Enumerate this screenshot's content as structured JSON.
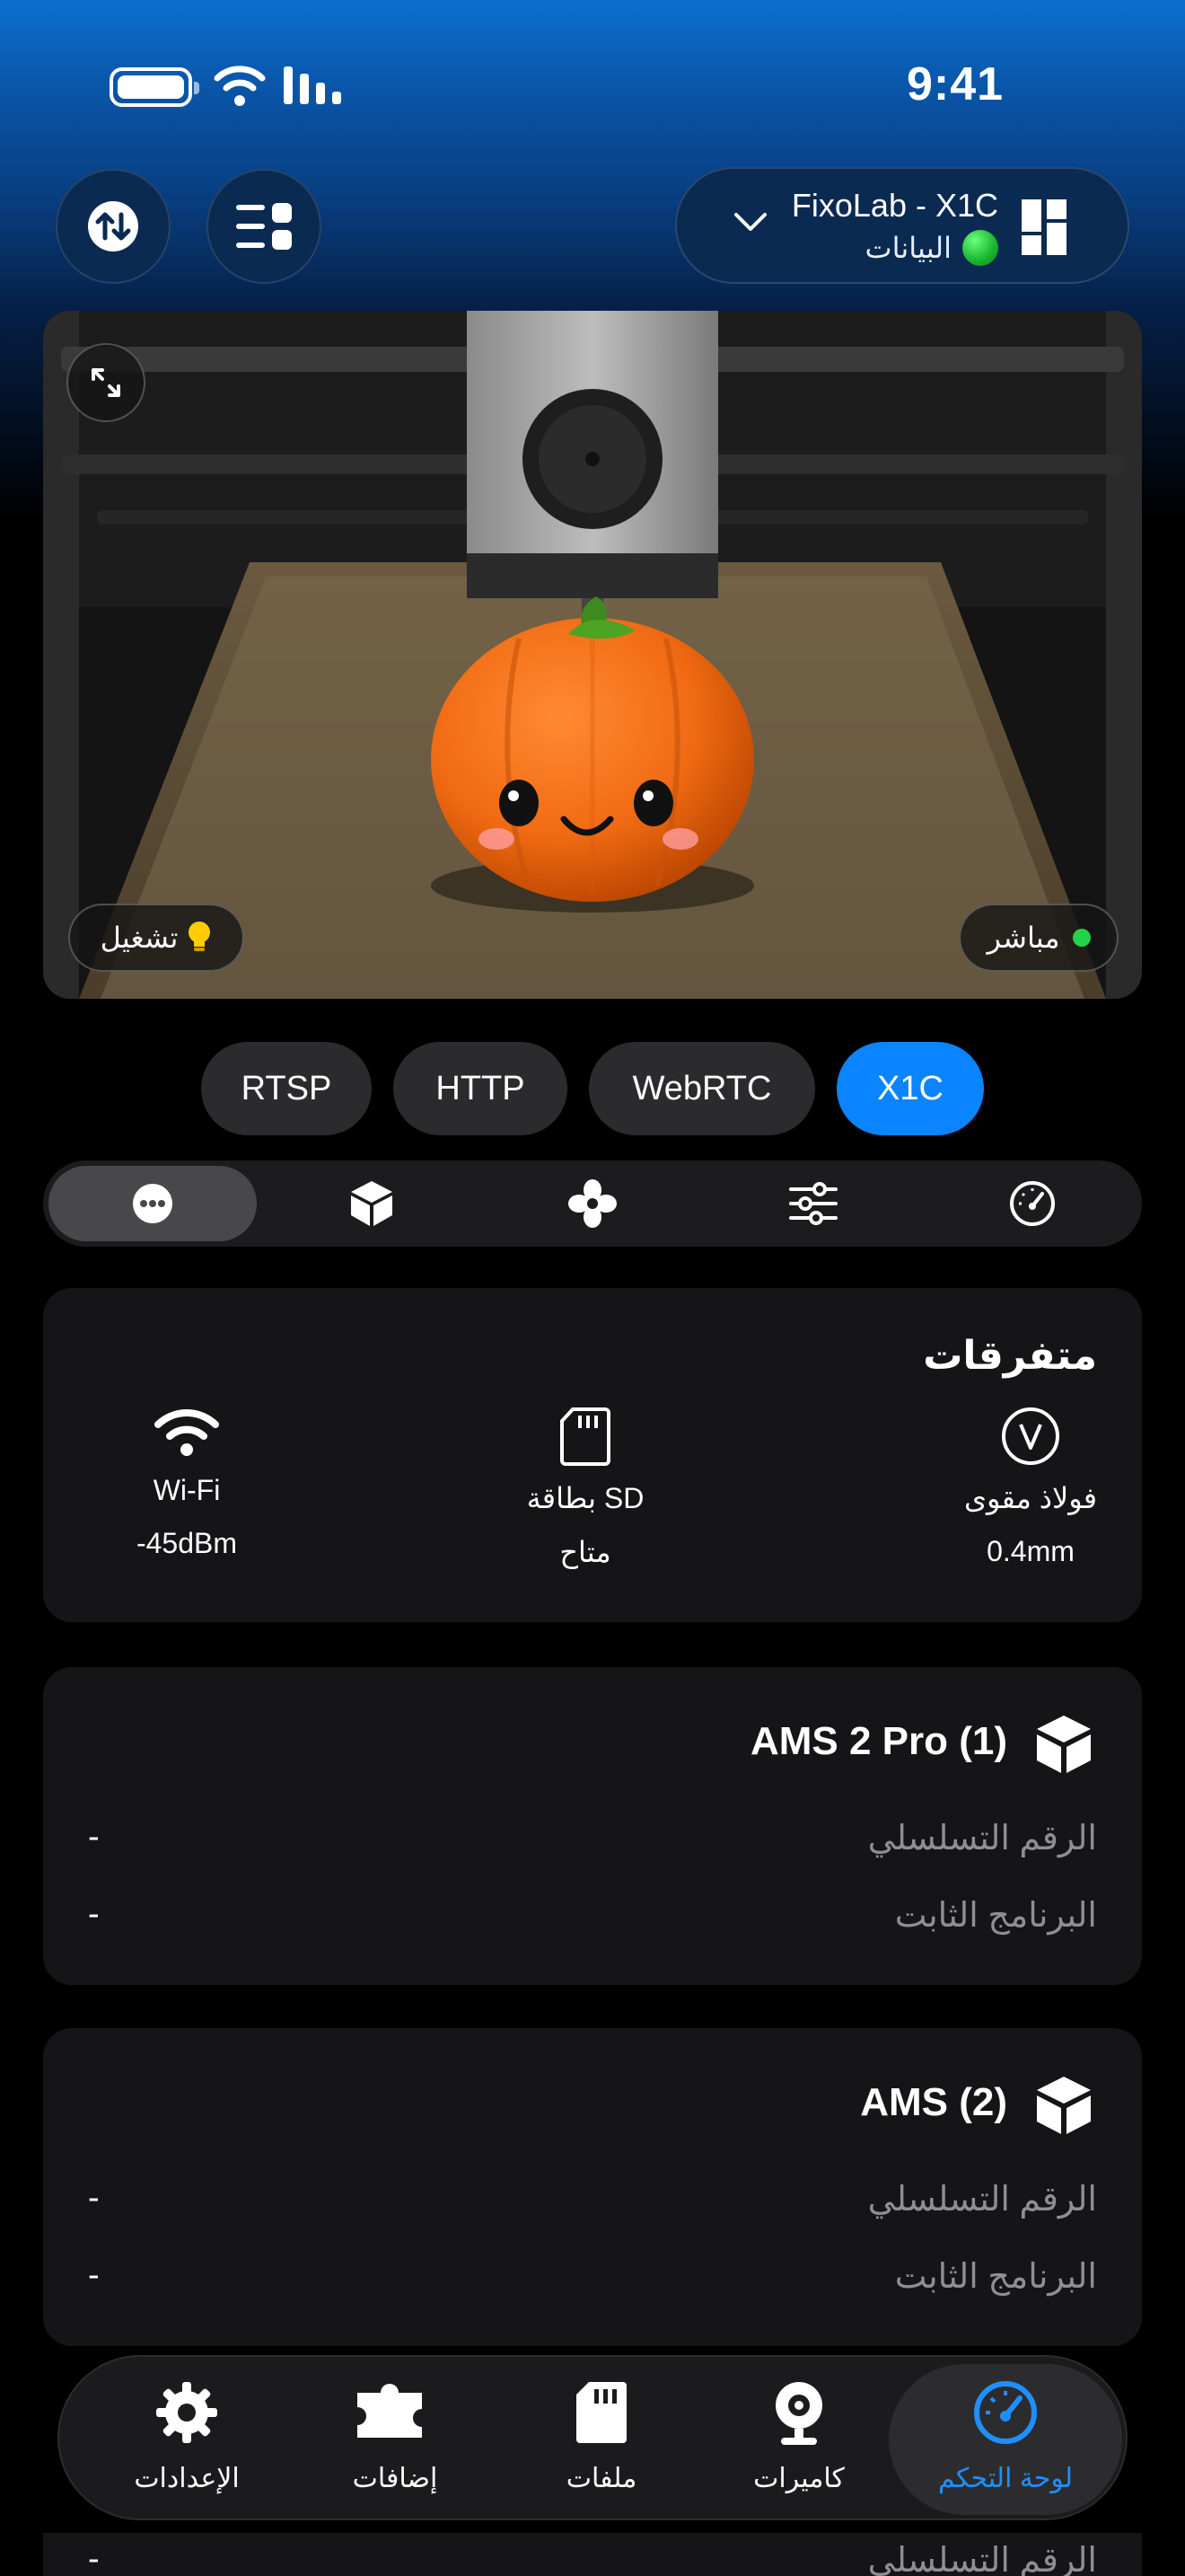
{
  "status_bar": {
    "time": "9:41"
  },
  "header": {
    "printer_name": "FixoLab - X1C",
    "printer_status": "البيانات"
  },
  "camera": {
    "light_label": "تشغيل",
    "live_label": "مباشر"
  },
  "sources": [
    "X1C",
    "WebRTC",
    "HTTP",
    "RTSP"
  ],
  "active_source": "X1C",
  "segments": [
    "more-icon",
    "cube-icon",
    "fan-icon",
    "sliders-icon",
    "gauge-icon"
  ],
  "misc": {
    "title": "متفرقات",
    "items": [
      {
        "icon": "wifi-icon",
        "label": "Wi-Fi",
        "value": "-45dBm"
      },
      {
        "icon": "sd-card-icon",
        "label": "بطاقة SD",
        "value": "متاح"
      },
      {
        "icon": "plate-icon",
        "label": "فولاذ مقوى",
        "value": "0.4mm"
      }
    ]
  },
  "ams_units": [
    {
      "title": "AMS 2 Pro (1)",
      "serial_label": "الرقم التسلسلي",
      "serial_value": "-",
      "firmware_label": "البرنامج الثابت",
      "firmware_value": "-"
    },
    {
      "title": "AMS (2)",
      "serial_label": "الرقم التسلسلي",
      "serial_value": "-",
      "firmware_label": "البرنامج الثابت",
      "firmware_value": "-"
    }
  ],
  "peek_row": {
    "label": "الرقم التسلسلي",
    "value": "-"
  },
  "tab_bar": [
    {
      "icon": "gear-icon",
      "label": "الإعدادات"
    },
    {
      "icon": "puzzle-icon",
      "label": "إضافات"
    },
    {
      "icon": "sd-card-icon",
      "label": "ملفات"
    },
    {
      "icon": "webcam-icon",
      "label": "كاميرات"
    },
    {
      "icon": "gauge-icon",
      "label": "لوحة التحكم"
    }
  ],
  "colors": {
    "accent": "#0a84ff",
    "card": "#151517",
    "online": "#22d34a"
  }
}
